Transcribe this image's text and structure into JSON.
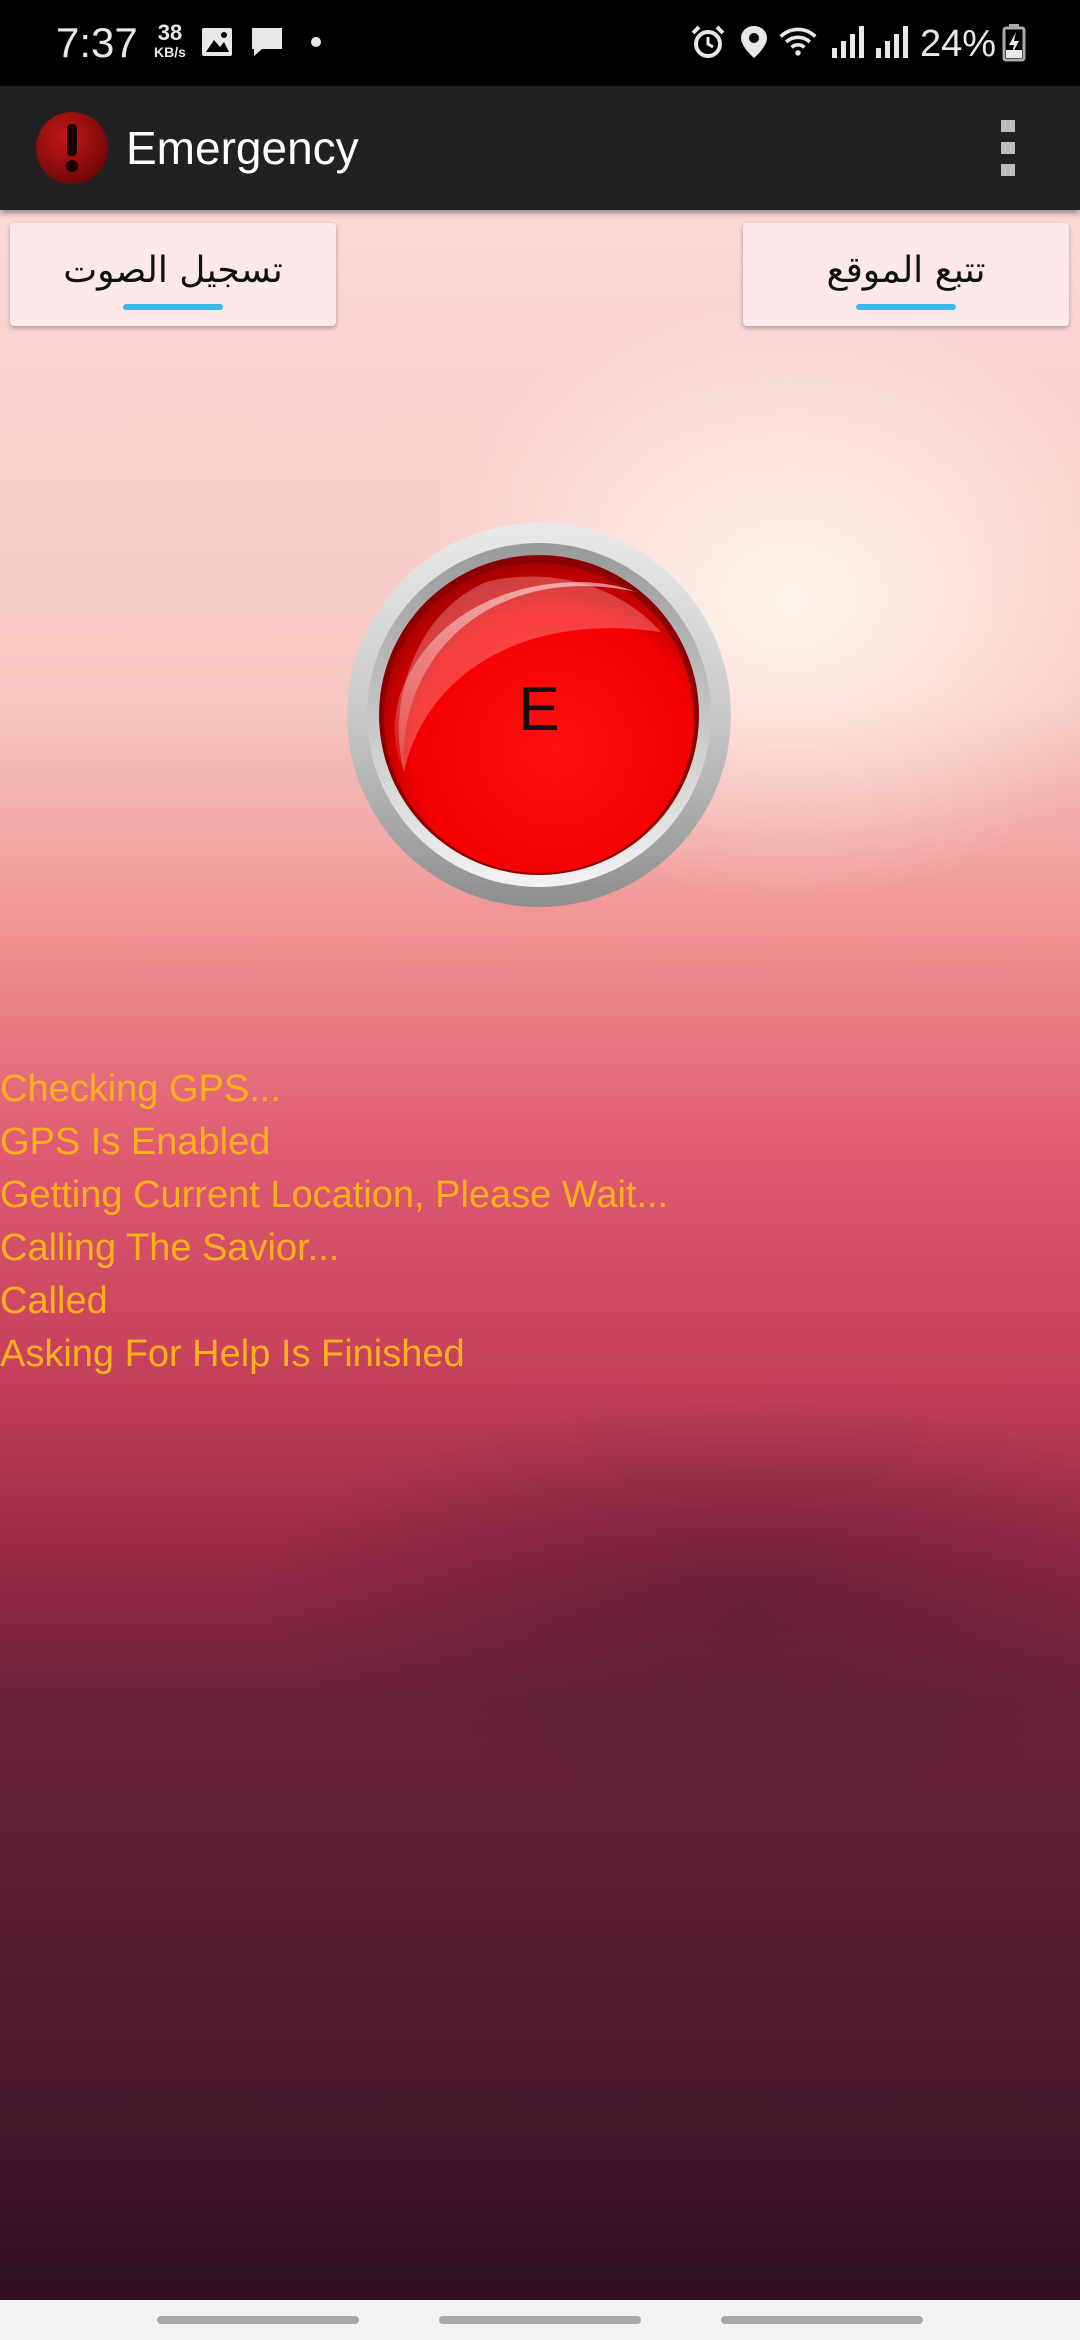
{
  "status_bar": {
    "time": "7:37",
    "net_speed_value": "38",
    "net_speed_unit": "KB/s",
    "battery_percent": "24%",
    "icons": [
      "gallery-icon",
      "message-icon",
      "dot-icon",
      "alarm-icon",
      "location-icon",
      "wifi-icon",
      "signal-icon",
      "signal-icon",
      "battery-charging-icon"
    ]
  },
  "app_bar": {
    "title": "Emergency",
    "logo_icon": "exclamation-icon",
    "menu_icon": "overflow-menu-icon"
  },
  "buttons": {
    "record_audio": "تسجيل الصوت",
    "track_location": "تتبع الموقع",
    "underline_color": "#3fb7e6"
  },
  "emergency_button": {
    "label": "E",
    "color": "#ff0000"
  },
  "log": {
    "color": "#f9b21c",
    "lines": [
      "Checking GPS...",
      "GPS Is Enabled",
      "Getting Current Location, Please Wait...",
      "Calling The Savior...",
      "Called",
      "Asking For Help Is Finished"
    ]
  }
}
